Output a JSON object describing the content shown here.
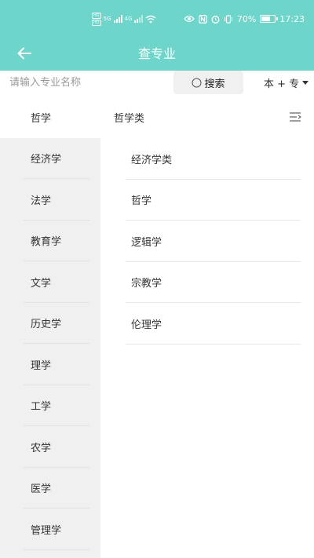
{
  "status_bar": {
    "hd_labels": [
      "HD",
      "HD"
    ],
    "network_5g": "5G",
    "network_4g": "4G",
    "battery_percent_text": "70%",
    "battery_level": 0.7,
    "time": "17:23",
    "icons": [
      "wifi-icon",
      "eye-icon",
      "nfc-icon",
      "alarm-icon",
      "vibrate-icon",
      "battery-icon"
    ]
  },
  "app_bar": {
    "title": "查专业",
    "back_icon": "arrow-left-icon"
  },
  "search": {
    "placeholder": "请输入专业名称",
    "value": "",
    "button_label": "搜索",
    "level_select": "本 + 专"
  },
  "sidebar": {
    "selected_index": 0,
    "items": [
      {
        "label": "哲学"
      },
      {
        "label": "经济学"
      },
      {
        "label": "法学"
      },
      {
        "label": "教育学"
      },
      {
        "label": "文学"
      },
      {
        "label": "历史学"
      },
      {
        "label": "理学"
      },
      {
        "label": "工学"
      },
      {
        "label": "农学"
      },
      {
        "label": "医学"
      },
      {
        "label": "管理学"
      }
    ]
  },
  "main": {
    "category_title": "哲学类",
    "items": [
      {
        "label": "经济学类"
      },
      {
        "label": "哲学"
      },
      {
        "label": "逻辑学"
      },
      {
        "label": "宗教学"
      },
      {
        "label": "伦理学"
      }
    ]
  },
  "colors": {
    "header": "#6dd5c9",
    "sidebar_bg": "#f0f0f0",
    "search_button_bg": "#f0f0f0"
  }
}
